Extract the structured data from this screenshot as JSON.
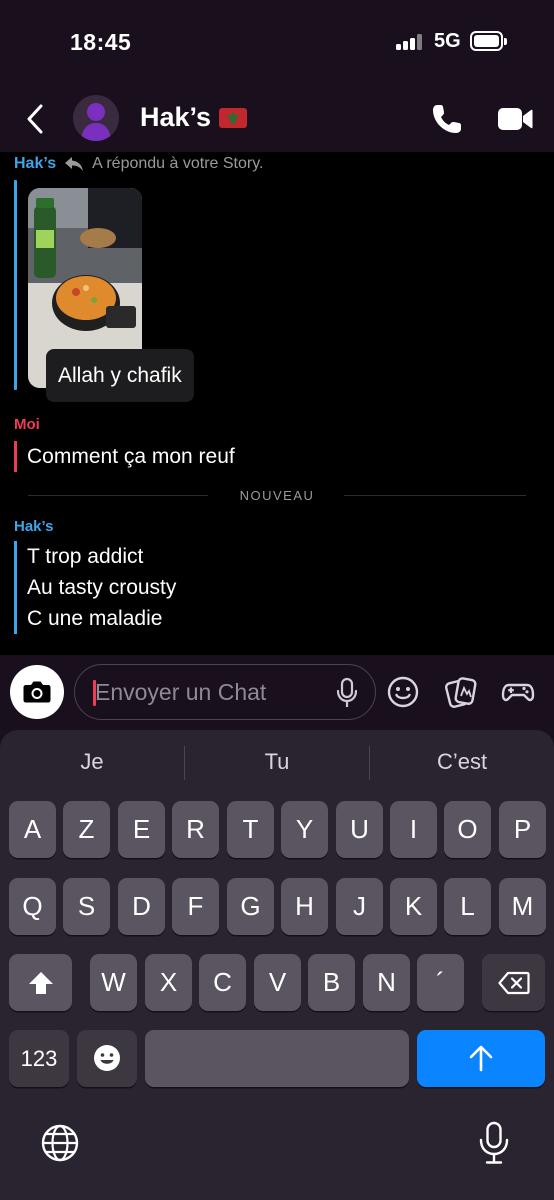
{
  "status_bar": {
    "time": "18:45",
    "network": "5G"
  },
  "header": {
    "title": "Hak’s"
  },
  "messages": {
    "reply_sender": "Hak’s",
    "reply_text": "A répondu à votre Story.",
    "story_caption": "Allah y chafik",
    "moi_label": "Moi",
    "moi_message": "Comment ça mon reuf",
    "divider_label": "NOUVEAU",
    "hak_label": "Hak’s",
    "hak_lines": [
      "T trop addict",
      "Au tasty crousty",
      "C une maladie"
    ]
  },
  "composer": {
    "placeholder": "Envoyer un Chat"
  },
  "keyboard": {
    "suggestions": [
      "Je",
      "Tu",
      "C’est"
    ],
    "row1": [
      "A",
      "Z",
      "E",
      "R",
      "T",
      "Y",
      "U",
      "I",
      "O",
      "P"
    ],
    "row2": [
      "Q",
      "S",
      "D",
      "F",
      "G",
      "H",
      "J",
      "K",
      "L",
      "M"
    ],
    "row3": [
      "W",
      "X",
      "C",
      "V",
      "B",
      "N",
      "´"
    ],
    "numbers_key": "123"
  },
  "colors": {
    "friend": "#3ea5e8",
    "me": "#ee3c57",
    "send": "#0a84ff"
  }
}
